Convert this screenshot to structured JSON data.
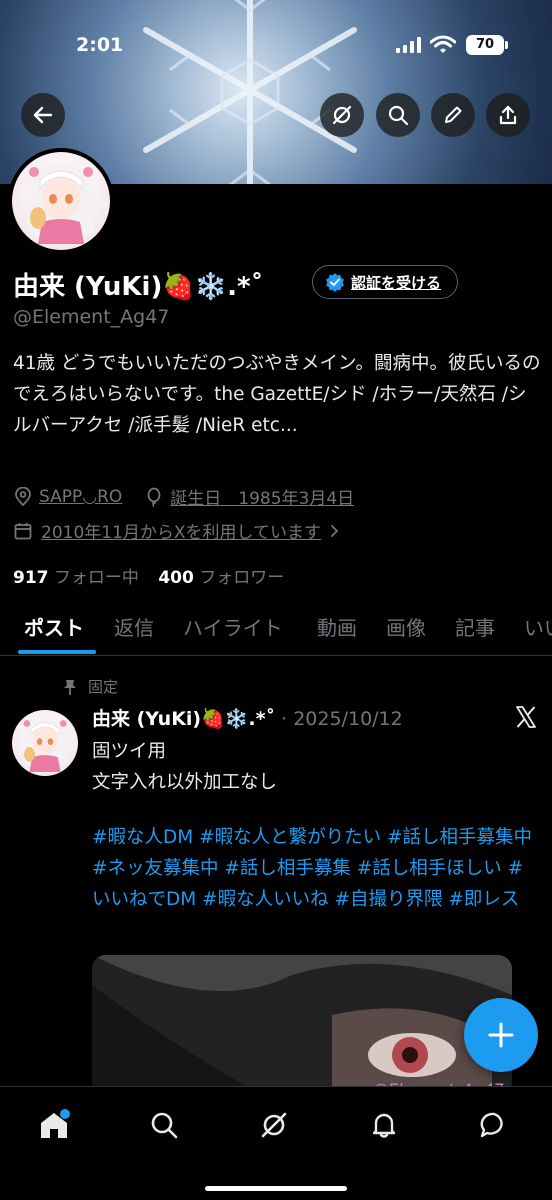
{
  "status_bar": {
    "time": "2:01",
    "battery": "70"
  },
  "header_buttons": {
    "back": "back-arrow-icon",
    "grok": "grok-icon",
    "search": "search-icon",
    "edit": "pencil-icon",
    "share": "share-icon"
  },
  "profile": {
    "display_name": "由来 (YuKi)🍓❄️.*˚",
    "verify_label": "認証を受ける",
    "handle": "@Element_Ag47",
    "bio": "41歳 どうでもいいただのつぶやきメイン。闘病中。彼氏いるのでえろはいらないです。the GazettE/シド /ホラー/天然石 /シルバーアクセ /派手髪 /NieR etc...",
    "location": "SAPP◡RO",
    "birthday": "誕生日　1985年3月4日",
    "joined": "2010年11月からXを利用しています",
    "following_count": "917",
    "following_label": "フォロー中",
    "followers_count": "400",
    "followers_label": "フォロワー"
  },
  "tabs": [
    "ポスト",
    "返信",
    "ハイライト",
    "動画",
    "画像",
    "記事",
    "いい"
  ],
  "active_tab": "ポスト",
  "post": {
    "pinned_label": "固定",
    "author": "由来 (YuKi)🍓❄️.*˚",
    "date": "· 2025/10/12",
    "text_line1": "固ツイ用",
    "text_line2": "文字入れ以外加工なし",
    "hashtags": "#暇な人DM #暇な人と繋がりたい #話し相手募集中 #ネッ友募集中 #話し相手募集 #話し相手ほしい #いいねでDM #暇な人いいね #自撮り界隈 #即レス",
    "watermark": "@Element_Ag47"
  },
  "colors": {
    "accent": "#1d9bf0",
    "muted": "#71767b",
    "background": "#000000"
  },
  "bottom_nav": [
    "home-icon",
    "search-icon",
    "grok-icon",
    "bell-icon",
    "messages-icon"
  ]
}
